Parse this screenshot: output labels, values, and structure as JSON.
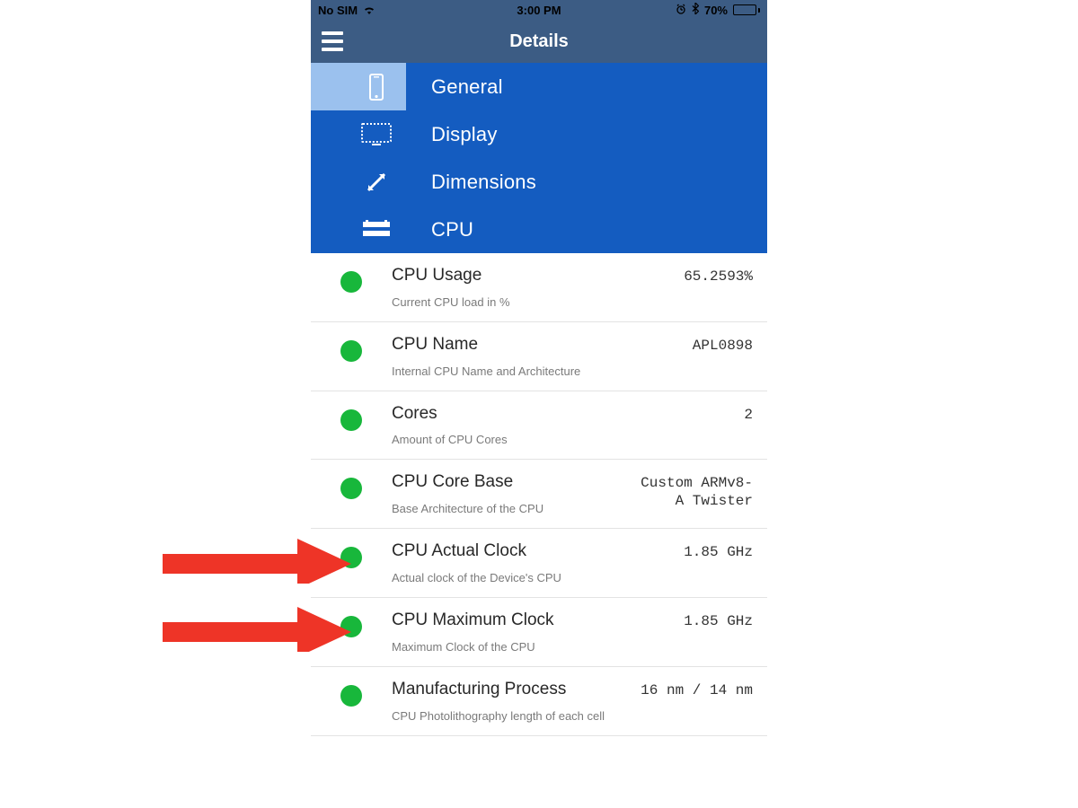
{
  "statusbar": {
    "carrier_text": "No SIM",
    "time": "3:00 PM",
    "battery_pct": "70%",
    "battery_fill_pct": 70
  },
  "header": {
    "title": "Details"
  },
  "tabs": [
    {
      "icon": "phone-icon",
      "label": "General"
    },
    {
      "icon": "display-icon",
      "label": "Display"
    },
    {
      "icon": "dimensions-icon",
      "label": "Dimensions"
    },
    {
      "icon": "cpu-icon",
      "label": "CPU"
    }
  ],
  "tabs_active_index": 0,
  "rows": [
    {
      "title": "CPU Usage",
      "subtitle": "Current CPU load in %",
      "value": "65.2593%"
    },
    {
      "title": "CPU Name",
      "subtitle": "Internal CPU Name and Architecture",
      "value": "APL0898"
    },
    {
      "title": "Cores",
      "subtitle": "Amount of CPU Cores",
      "value": "2"
    },
    {
      "title": "CPU Core Base",
      "subtitle": "Base Architecture of the CPU",
      "value": "Custom ARMv8-\nA Twister"
    },
    {
      "title": "CPU Actual Clock",
      "subtitle": "Actual clock of the Device's CPU",
      "value": "1.85 GHz"
    },
    {
      "title": "CPU Maximum Clock",
      "subtitle": "Maximum Clock of the CPU",
      "value": "1.85 GHz"
    },
    {
      "title": "Manufacturing Process",
      "subtitle": "CPU Photolithography length of each cell",
      "value": "16 nm / 14 nm"
    }
  ],
  "annotations": {
    "arrow_color": "#ee3427",
    "arrows": [
      {
        "targets_row_index": 4
      },
      {
        "targets_row_index": 5
      }
    ]
  },
  "colors": {
    "header_bg": "#3c5c84",
    "tabs_bg": "#145cc0",
    "tabs_icon_active_bg": "#9bc1ee",
    "dot": "#18b73b"
  }
}
